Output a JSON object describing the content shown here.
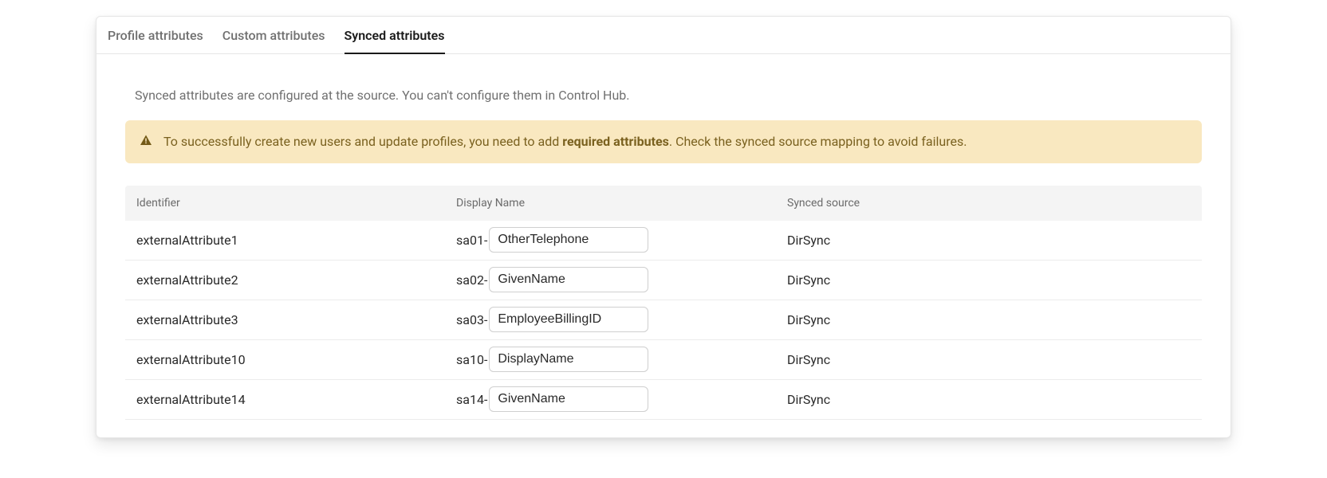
{
  "tabs": {
    "items": [
      {
        "label": "Profile attributes",
        "active": false
      },
      {
        "label": "Custom attributes",
        "active": false
      },
      {
        "label": "Synced attributes",
        "active": true
      }
    ]
  },
  "intro": "Synced attributes are configured at the source. You can't configure them in Control Hub.",
  "alert": {
    "before": "To successfully create new users and update profiles, you need to add ",
    "strong": "required attributes",
    "after": ". Check the synced source mapping to avoid failures."
  },
  "table": {
    "columns": [
      "Identifier",
      "Display Name",
      "Synced source"
    ],
    "rows": [
      {
        "identifier": "externalAttribute1",
        "prefix": "sa01-",
        "value": "OtherTelephone",
        "source": "DirSync"
      },
      {
        "identifier": "externalAttribute2",
        "prefix": "sa02-",
        "value": "GivenName",
        "source": "DirSync"
      },
      {
        "identifier": "externalAttribute3",
        "prefix": "sa03-",
        "value": "EmployeeBillingID",
        "source": "DirSync"
      },
      {
        "identifier": "externalAttribute10",
        "prefix": "sa10-",
        "value": "DisplayName",
        "source": "DirSync"
      },
      {
        "identifier": "externalAttribute14",
        "prefix": "sa14-",
        "value": "GivenName",
        "source": "DirSync"
      }
    ]
  }
}
